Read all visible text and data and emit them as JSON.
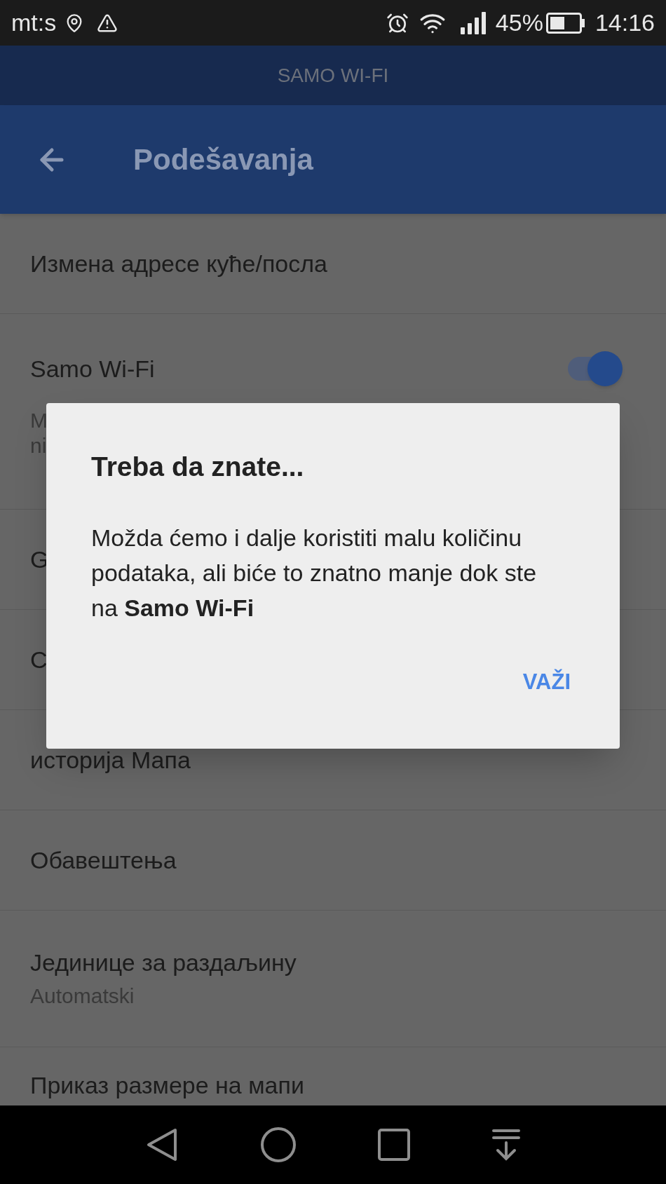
{
  "status_bar": {
    "carrier": "mt:s",
    "battery": "45%",
    "time": "14:16"
  },
  "banner": {
    "title": "SAMO WI-FI"
  },
  "app_bar": {
    "title": "Podešavanja"
  },
  "settings": [
    {
      "kind": "item",
      "title": "Измена адресе куће/посла"
    },
    {
      "kind": "toggle",
      "title": "Samo Wi-Fi",
      "on": true,
      "subtitle_lines": [
        "M",
        "ni"
      ]
    },
    {
      "kind": "item",
      "title": "G"
    },
    {
      "kind": "item",
      "title": "C"
    },
    {
      "kind": "item",
      "title": "историја Мапа"
    },
    {
      "kind": "item",
      "title": "Обавештења"
    },
    {
      "kind": "item",
      "title": "Јединице за раздаљину",
      "subtitle": "Automatski"
    },
    {
      "kind": "last",
      "title": "Приказ размере на мапи"
    }
  ],
  "dialog": {
    "title": "Treba da znate...",
    "body": "Možda ćemo i dalje koristiti malu količinu podataka, ali biće to znatno manje dok ste na **Samo Wi-Fi**",
    "button": "VAŽI"
  }
}
